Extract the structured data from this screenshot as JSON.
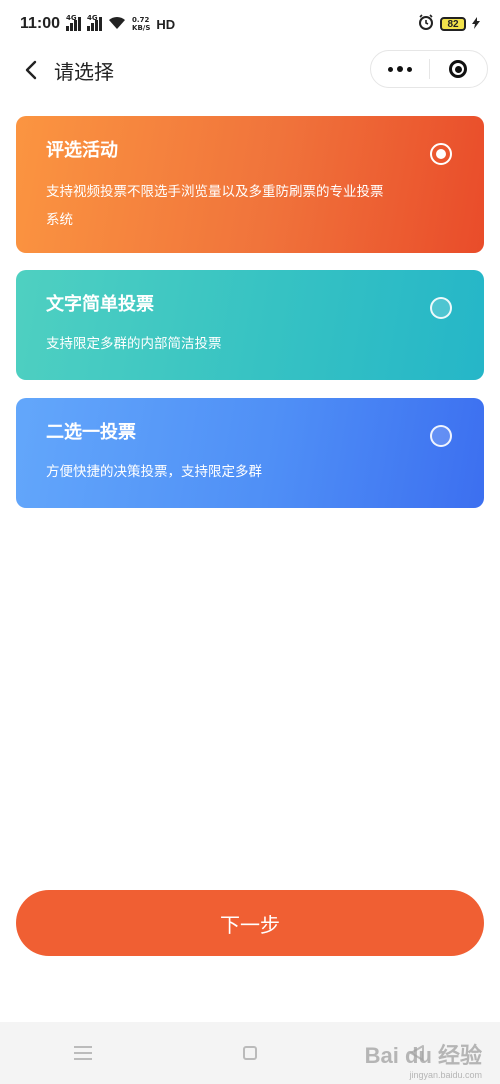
{
  "status_bar": {
    "time": "11:00",
    "sim1_label": "4G",
    "sim2_label": "4G",
    "speed_value": "0.72",
    "speed_unit": "KB/S",
    "hd_label": "HD",
    "battery_level": "82",
    "icons": [
      "signal-icon",
      "wifi-icon",
      "alarm-icon",
      "battery-icon",
      "charging-icon"
    ]
  },
  "nav": {
    "title": "请选择",
    "icons": [
      "back-arrow-icon",
      "more-dots-icon",
      "close-target-icon"
    ]
  },
  "options": [
    {
      "title": "评选活动",
      "description": "支持视频投票不限选手浏览量以及多重防刷票的专业投票系统",
      "selected": true,
      "colors": [
        "#fb9541",
        "#e94c2a"
      ]
    },
    {
      "title": "文字简单投票",
      "description": "支持限定多群的内部简洁投票",
      "selected": false,
      "colors": [
        "#4fd0c1",
        "#25b6c8"
      ]
    },
    {
      "title": "二选一投票",
      "description": "方便快捷的决策投票，支持限定多群",
      "selected": false,
      "colors": [
        "#63a7fb",
        "#3c6ff0"
      ]
    }
  ],
  "next_button": {
    "label": "下一步",
    "color": "#f05f33"
  },
  "system_nav": {
    "icons": [
      "menu-icon",
      "home-icon",
      "back-triangle-icon"
    ]
  },
  "watermark": {
    "text": "Bai du 经验",
    "sub": "jingyan.baidu.com"
  }
}
